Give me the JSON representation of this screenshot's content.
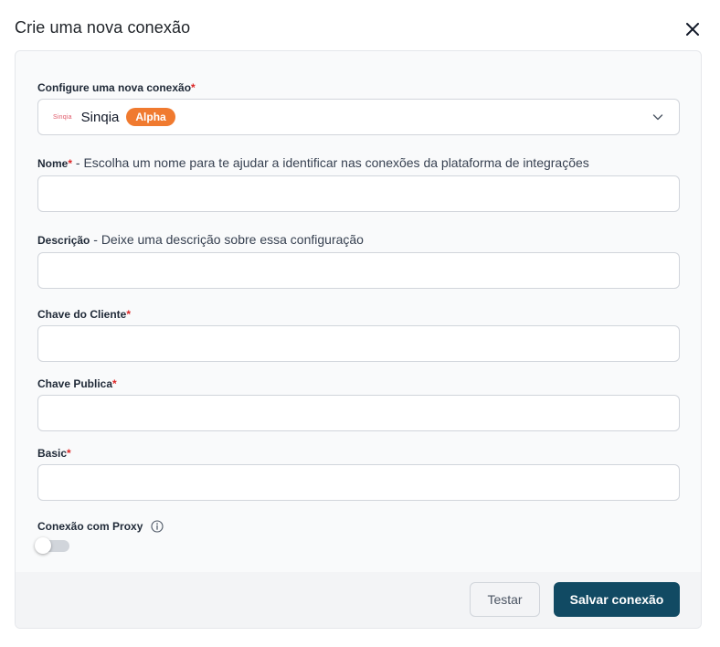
{
  "modal": {
    "title": "Crie uma nova conexão"
  },
  "connector_select": {
    "label": "Configure uma nova conexão",
    "required_mark": "*",
    "logo_text": "Sinqia",
    "value": "Sinqia",
    "badge": "Alpha"
  },
  "fields": {
    "name": {
      "label": "Nome",
      "required_mark": "*",
      "hint": " - Escolha um nome para te ajudar a identificar nas conexões da plataforma de integrações",
      "value": ""
    },
    "description": {
      "label": "Descrição",
      "hint": " - Deixe uma descrição sobre essa configuração",
      "value": ""
    },
    "client_key": {
      "label": "Chave do Cliente",
      "required_mark": "*",
      "value": ""
    },
    "public_key": {
      "label": "Chave Publica",
      "required_mark": "*",
      "value": ""
    },
    "basic": {
      "label": "Basic",
      "required_mark": "*",
      "value": ""
    }
  },
  "proxy": {
    "label": "Conexão com Proxy",
    "enabled": false
  },
  "footer": {
    "test_label": "Testar",
    "save_label": "Salvar conexão"
  },
  "colors": {
    "primary": "#114a63",
    "badge": "#f07a2f",
    "required": "#dc2626"
  },
  "icons": {
    "close": "close-icon",
    "chevron": "chevron-down-icon",
    "info": "info-icon"
  }
}
